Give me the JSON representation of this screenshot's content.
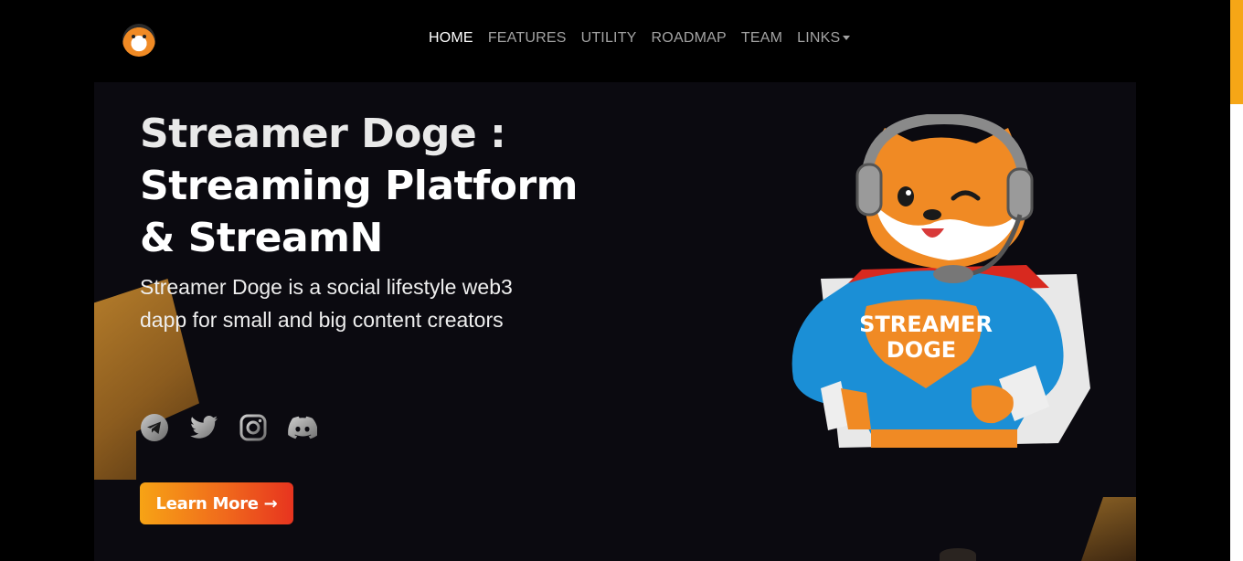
{
  "nav": {
    "items": [
      {
        "label": "HOME",
        "active": true
      },
      {
        "label": "FEATURES",
        "active": false
      },
      {
        "label": "UTILITY",
        "active": false
      },
      {
        "label": "ROADMAP",
        "active": false
      },
      {
        "label": "TEAM",
        "active": false
      },
      {
        "label": "LINKS",
        "active": false,
        "dropdown": true
      }
    ]
  },
  "hero": {
    "title_line1": "Streamer Doge :",
    "title_line2": "Streaming Platform",
    "title_line3": "& StreamN",
    "subtitle": "Streamer Doge is a social lifestyle web3 dapp for small and big content creators",
    "cta_label": "Learn More",
    "mascot_badge_line1": "STREAMER",
    "mascot_badge_line2": "DOGE"
  },
  "socials": [
    "telegram-icon",
    "twitter-icon",
    "instagram-icon",
    "discord-icon"
  ],
  "colors": {
    "accent": "#f6a616",
    "cta_start": "#f7a315",
    "cta_end": "#e7341f",
    "hero_bg": "#0b0a10"
  }
}
